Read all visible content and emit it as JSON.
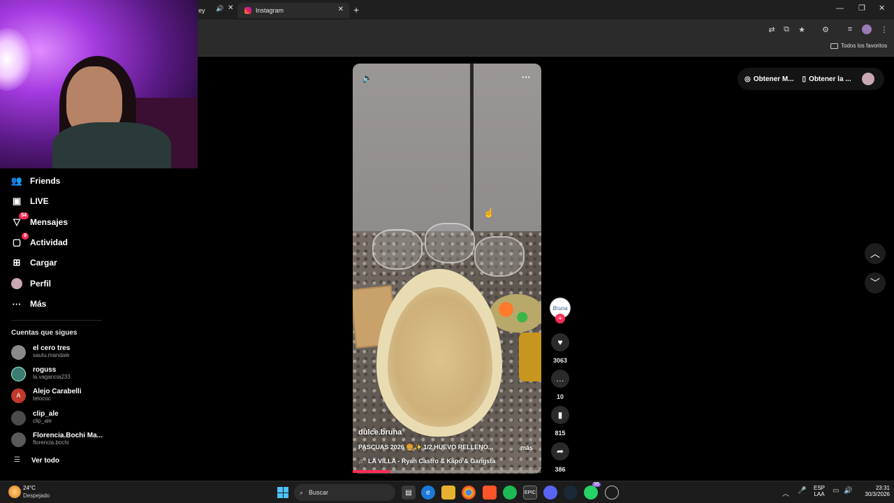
{
  "browser": {
    "tab_prev_title": "ey",
    "tab_active_title": "Instagram",
    "new_tab_symbol": "+",
    "bookmarks_label": "Todos los favoritos"
  },
  "sidebar": {
    "items": [
      {
        "label": "Friends",
        "icon": "friends-icon"
      },
      {
        "label": "LIVE",
        "icon": "live-icon"
      },
      {
        "label": "Mensajes",
        "icon": "messages-icon",
        "badge": "54"
      },
      {
        "label": "Actividad",
        "icon": "activity-icon",
        "badge": "9"
      },
      {
        "label": "Cargar",
        "icon": "upload-icon"
      },
      {
        "label": "Perfil",
        "icon": "profile-icon"
      },
      {
        "label": "Más",
        "icon": "more-icon"
      }
    ],
    "following_title": "Cuentas que sigues",
    "accounts": [
      {
        "name": "el cero tres",
        "handle": "sautu.mandale"
      },
      {
        "name": "roguss",
        "handle": "la.vagancia233"
      },
      {
        "name": "Alejo Carabelli",
        "handle": "tetococ",
        "initial": "A"
      },
      {
        "name": "clip_ale",
        "handle": "clip_ale"
      },
      {
        "name": "Florencia.Bochi Ma...",
        "handle": "florencia.bochi"
      }
    ],
    "see_all": "Ver todo"
  },
  "video": {
    "username": "dulce.bruna",
    "caption": "PASCUAS 2026 🍔✨ 1/2 HUEVO RELLENO...",
    "more_label": "más",
    "music": "LA VILLA - Ryan Castro & Kapo & Gangsta",
    "progress": 0.2
  },
  "actions": {
    "avatar_text": "Bruna",
    "likes": "3063",
    "comments": "10",
    "saves": "815",
    "shares": "386"
  },
  "topright": {
    "coins_label": "Obtener M...",
    "app_label": "Obtener la ..."
  },
  "taskbar": {
    "weather_temp": "24°C",
    "weather_desc": "Despejado",
    "search_label": "Buscar",
    "lang_top": "ESP",
    "lang_bottom": "LAA",
    "time": "23:31",
    "date": "30/3/2026",
    "whatsapp_badge": "36"
  },
  "colors": {
    "accent": "#fe2c55",
    "background": "#000000"
  }
}
